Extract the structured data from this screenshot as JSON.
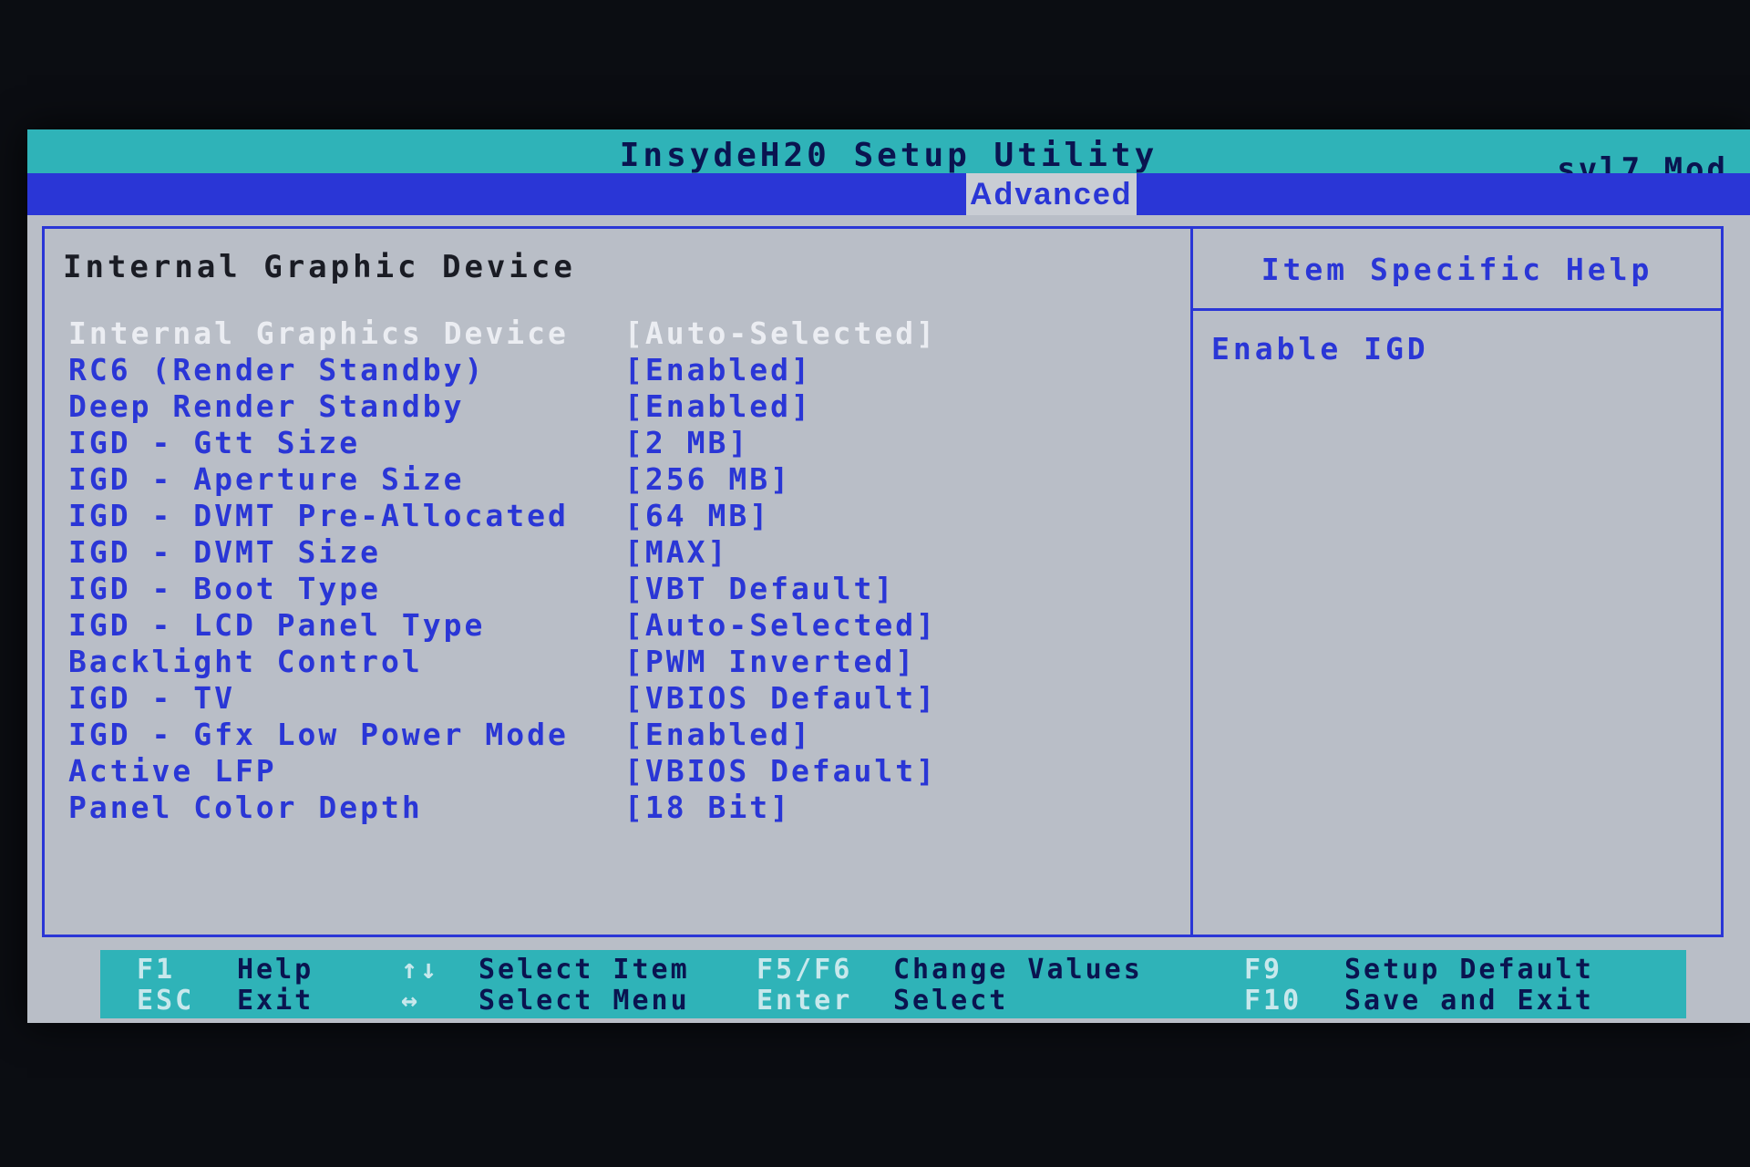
{
  "title_bar": {
    "title": "InsydeH20 Setup Utility",
    "model": "svl7 Mod"
  },
  "menu": {
    "active_tab": "Advanced"
  },
  "section": {
    "title": "Internal Graphic Device"
  },
  "settings": [
    {
      "label": "Internal Graphics Device",
      "value": "[Auto-Selected]",
      "selected": true
    },
    {
      "label": "RC6 (Render Standby)",
      "value": "[Enabled]"
    },
    {
      "label": "Deep Render Standby",
      "value": "[Enabled]"
    },
    {
      "label": "IGD - Gtt Size",
      "value": "[2 MB]"
    },
    {
      "label": "IGD - Aperture Size",
      "value": "[256 MB]"
    },
    {
      "label": "IGD - DVMT Pre-Allocated",
      "value": "[64 MB]"
    },
    {
      "label": "IGD - DVMT Size",
      "value": "[MAX]"
    },
    {
      "label": "IGD - Boot Type",
      "value": "[VBT Default]"
    },
    {
      "label": "IGD - LCD Panel Type",
      "value": "[Auto-Selected]"
    },
    {
      "label": "Backlight Control",
      "value": "[PWM Inverted]"
    },
    {
      "label": "IGD - TV",
      "value": "[VBIOS Default]"
    },
    {
      "label": "IGD - Gfx Low Power Mode",
      "value": "[Enabled]"
    },
    {
      "label": "Active LFP",
      "value": "[VBIOS Default]"
    },
    {
      "label": "Panel Color Depth",
      "value": "[18 Bit]"
    }
  ],
  "help": {
    "title": "Item Specific Help",
    "text": "Enable IGD"
  },
  "footer": {
    "f1_key": "F1",
    "f1_desc": "Help",
    "esc_key": "ESC",
    "esc_desc": "Exit",
    "updown_key": "↑↓",
    "updown_desc": "Select Item",
    "leftright_key": "↔",
    "leftright_desc": "Select Menu",
    "f5f6_key": "F5/F6",
    "f5f6_desc": "Change Values",
    "enter_key": "Enter",
    "enter_desc": "Select",
    "f9_key": "F9",
    "f9_desc": "Setup Default",
    "f10_key": "F10",
    "f10_desc": "Save and Exit"
  }
}
